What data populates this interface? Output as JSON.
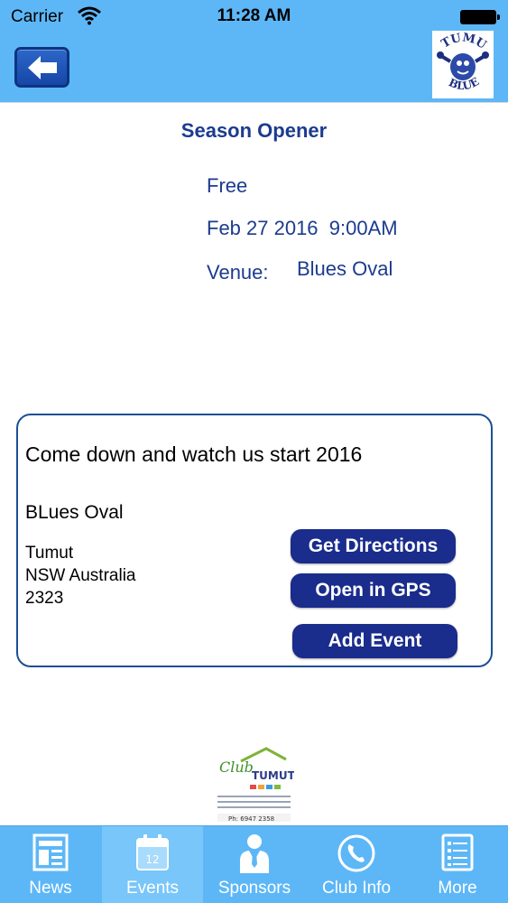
{
  "status_bar": {
    "carrier": "Carrier",
    "time": "11:28 AM"
  },
  "nav": {
    "back_icon": "left-arrow-icon",
    "logo_top": "TUMUT",
    "logo_bottom": "BLUES"
  },
  "event": {
    "title": "Season Opener",
    "price": "Free",
    "datetime": "Feb 27 2016  9:00AM",
    "venue_label": "Venue:",
    "venue_value": "Blues Oval"
  },
  "details": {
    "description": "Come down and watch us start 2016",
    "location_name": "BLues Oval",
    "address_lines": [
      "Tumut",
      "NSW Australia",
      "2323"
    ],
    "buttons": {
      "directions": "Get Directions",
      "gps": "Open in GPS",
      "add_event": "Add Event"
    }
  },
  "sponsor": {
    "title_script": "Club",
    "title_main": "TUMUT",
    "phone": "Ph: 6947 2358"
  },
  "tabs": [
    {
      "label": "News",
      "icon": "news-icon"
    },
    {
      "label": "Events",
      "icon": "calendar-icon",
      "badge": "12"
    },
    {
      "label": "Sponsors",
      "icon": "person-tie-icon"
    },
    {
      "label": "Club Info",
      "icon": "phone-icon"
    },
    {
      "label": "More",
      "icon": "list-icon"
    }
  ],
  "colors": {
    "bar": "#5db7f7",
    "accent_text": "#1c3b8f",
    "button": "#1a2c8c",
    "active_tab": "#78c6fa"
  }
}
